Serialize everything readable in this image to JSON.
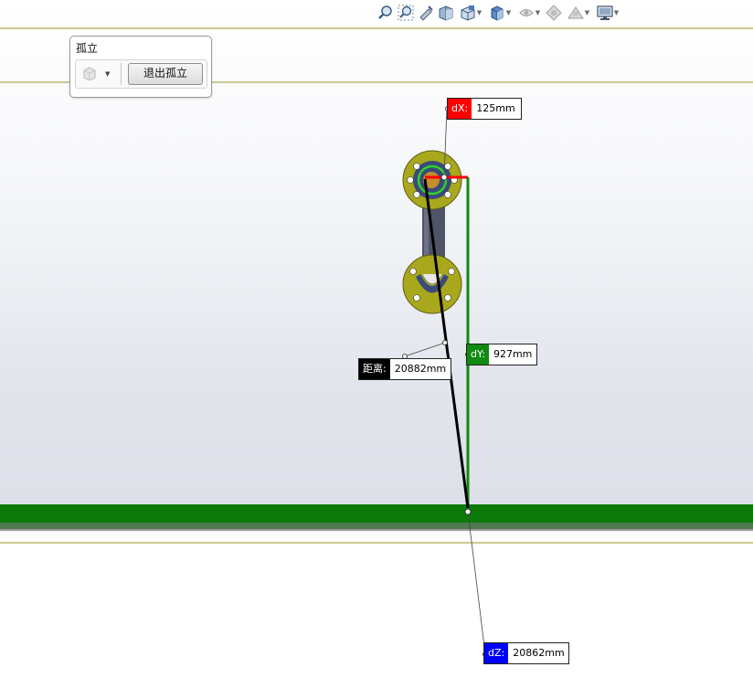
{
  "isolate": {
    "title": "孤立",
    "exit_button": "退出孤立"
  },
  "toolbar": {
    "items": [
      {
        "icon": "zoom-to-fit-icon"
      },
      {
        "icon": "zoom-to-area-icon"
      },
      {
        "icon": "previous-view-icon"
      },
      {
        "icon": "section-view-icon"
      },
      {
        "icon": "view-orientation-icon",
        "dropdown": true
      },
      {
        "icon": "display-style-icon",
        "dropdown": true
      },
      {
        "icon": "hide-show-items-icon",
        "dropdown": true
      },
      {
        "icon": "edit-appearance-icon"
      },
      {
        "icon": "apply-scene-icon",
        "dropdown": true
      },
      {
        "icon": "view-settings-icon",
        "dropdown": true
      }
    ]
  },
  "measure": {
    "dx": {
      "label": "dX:",
      "value": "125mm",
      "color": "#ff0000"
    },
    "dy": {
      "label": "dY:",
      "value": "927mm",
      "color": "#008000"
    },
    "dz": {
      "label": "dZ:",
      "value": "20862mm",
      "color": "#0000ff"
    },
    "distance": {
      "label": "距离:",
      "value": "20882mm",
      "color": "#000000"
    }
  },
  "colors": {
    "flange": "#a9a81c",
    "flange_dark": "#5f5e10",
    "pipe": "#4f5466",
    "floor": "#0b7a0b",
    "plane_line": "#9b9520"
  }
}
